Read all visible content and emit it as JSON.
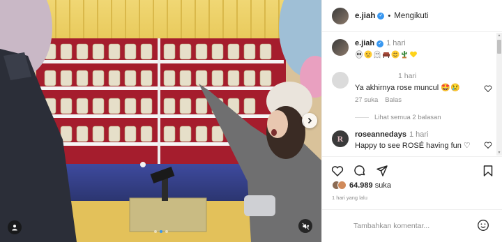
{
  "header": {
    "username": "e.jiah",
    "separator": "•",
    "follow_label": "Mengikuti"
  },
  "caption": {
    "username": "e.jiah",
    "time": "1 hari",
    "emojis": [
      "alien-emoji",
      "woozy-face-emoji",
      "ghost-emoji",
      "sofa-emoji",
      "smiling-face-emoji",
      "cactus-emoji",
      "yellow-heart-emoji"
    ]
  },
  "comments": [
    {
      "username": "",
      "time": "1 hari",
      "text": "Ya akhirnya rose muncul 🤩😢",
      "likes": "27 suka",
      "reply_label": "Balas"
    },
    {
      "username": "roseannedays",
      "time": "1 hari",
      "text": "Happy to see ROSÉ having fun ♡"
    }
  ],
  "view_replies": "Lihat semua 2 balasan",
  "likes": {
    "count": "64.989",
    "suffix": "suka"
  },
  "posted_ago": "1 hari yang lalu",
  "add_comment": {
    "placeholder": "Tambahkan komentar..."
  },
  "carousel": {
    "count": 3,
    "active": 2
  },
  "icons": {
    "verified": "verified-badge-icon",
    "heart": "heart-icon",
    "comment": "comment-icon",
    "share": "share-icon",
    "save": "bookmark-icon",
    "next": "chevron-right-icon",
    "tag": "user-tag-icon",
    "mute": "muted-speaker-icon",
    "emoji": "smile-icon"
  },
  "colors": {
    "accent": "#3897f0",
    "text": "#262626",
    "secondary": "#8e8e8e"
  }
}
